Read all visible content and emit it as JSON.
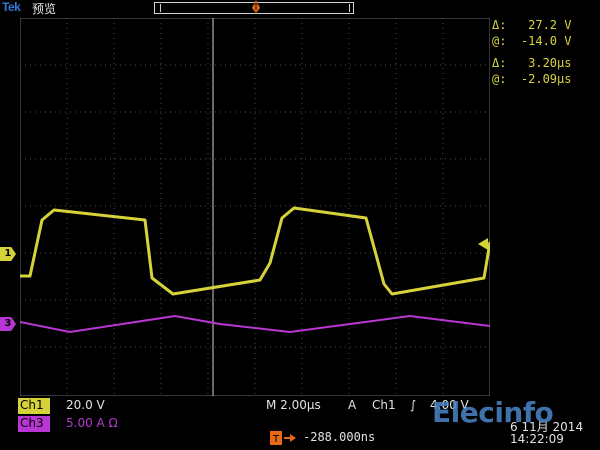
{
  "header": {
    "brand": "Tek",
    "mode": "预览"
  },
  "cursor": {
    "delta_v": "Δ:   27.2 V",
    "at_v": "@:  -14.0 V",
    "delta_t": "Δ:   3.20µs",
    "at_t": "@:  -2.09µs"
  },
  "markers": {
    "ch1": "1",
    "ch3": "3",
    "trigger_top": "T",
    "trigger_pos": "T"
  },
  "bottom": {
    "ch1_label": "Ch1",
    "ch1_scale": "20.0 V",
    "ch3_label": "Ch3",
    "ch3_scale": "5.00 A Ω",
    "timebase": "M 2.00µs",
    "trig_mode": "A",
    "trig_channel": "Ch1",
    "trig_slope": "∫",
    "trig_level": "4.00 V",
    "offset": "-288.000ns",
    "date": "6 11月 2014",
    "time": "14:22:09",
    "logo": "Elecinfo"
  },
  "colors": {
    "ch1": "#d6d23a",
    "ch3": "#b836d3",
    "trigger": "#e66a15",
    "grid": "#6b6b6b",
    "text": "#e2e2e2",
    "cursor_text": "#d8d440"
  }
}
